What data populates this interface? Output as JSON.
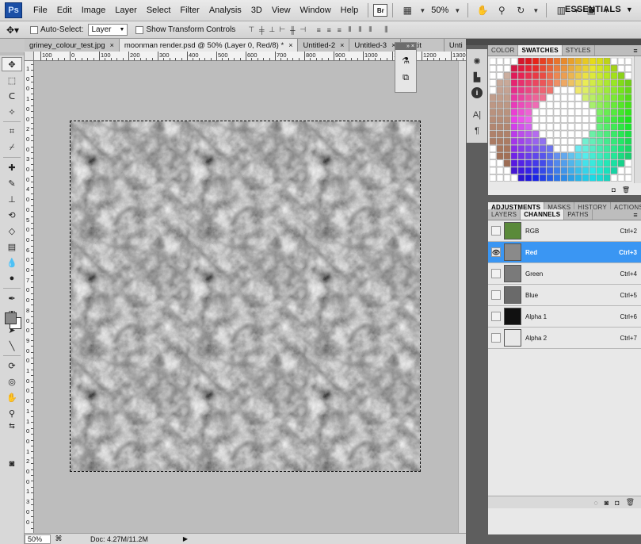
{
  "app": {
    "logo": "Ps",
    "menu": [
      "File",
      "Edit",
      "Image",
      "Layer",
      "Select",
      "Filter",
      "Analysis",
      "3D",
      "View",
      "Window",
      "Help"
    ],
    "bridge_label": "Br",
    "zoom": "50%",
    "workspace": "ESSENTIALS"
  },
  "options": {
    "auto_select_label": "Auto-Select:",
    "auto_select_value": "Layer",
    "show_transform_label": "Show Transform Controls"
  },
  "tabs": [
    {
      "label": "grimey_colour_test.jpg",
      "active": false
    },
    {
      "label": "moonman render.psd @ 50% (Layer 0, Red/8) *",
      "active": true
    },
    {
      "label": "Untitled-2",
      "active": false
    },
    {
      "label": "Untitled-3",
      "active": false
    },
    {
      "label": "Untit",
      "active": false
    },
    {
      "label": "Unti",
      "active": false
    }
  ],
  "ruler": {
    "h_labels": [
      "100",
      "0",
      "100",
      "200",
      "300",
      "400",
      "500",
      "600",
      "700",
      "800",
      "900",
      "1000",
      "1100",
      "1200",
      "1300"
    ],
    "v_labels": [
      "1",
      "0",
      "0",
      "1",
      "0",
      "0",
      "2",
      "0",
      "0",
      "3",
      "0",
      "0",
      "4",
      "0",
      "0",
      "5",
      "0",
      "0",
      "6",
      "0",
      "0",
      "7",
      "0",
      "0",
      "8",
      "0",
      "0",
      "9",
      "0",
      "0",
      "1",
      "0",
      "0",
      "0",
      "1",
      "1",
      "0",
      "0",
      "1",
      "2",
      "0",
      "0",
      "1",
      "3",
      "0",
      "0"
    ]
  },
  "status": {
    "zoom": "50%",
    "doc_info": "Doc: 4.27M/11.2M"
  },
  "panels": {
    "top_tabs": [
      "COLOR",
      "SWATCHES",
      "STYLES"
    ],
    "top_active": "SWATCHES",
    "mid_tabs": [
      "ADJUSTMENTS",
      "MASKS",
      "HISTORY",
      "ACTIONS"
    ],
    "layer_tabs": [
      "LAYERS",
      "CHANNELS",
      "PATHS"
    ],
    "layer_active": "CHANNELS"
  },
  "channels": [
    {
      "name": "RGB",
      "shortcut": "Ctrl+2",
      "selected": false,
      "thumb": "#5a8a3a"
    },
    {
      "name": "Red",
      "shortcut": "Ctrl+3",
      "selected": true,
      "thumb": "#8a8a8a"
    },
    {
      "name": "Green",
      "shortcut": "Ctrl+4",
      "selected": false,
      "thumb": "#7a7a7a"
    },
    {
      "name": "Blue",
      "shortcut": "Ctrl+5",
      "selected": false,
      "thumb": "#6a6a6a"
    },
    {
      "name": "Alpha 1",
      "shortcut": "Ctrl+6",
      "selected": false,
      "thumb": "#111111"
    },
    {
      "name": "Alpha 2",
      "shortcut": "Ctrl+7",
      "selected": false,
      "thumb": "#e8e8e8"
    }
  ],
  "colors": {
    "selection": "#3a96f3",
    "canvas_bg": "#bdbdbd",
    "dock": "#5e5e5e"
  }
}
